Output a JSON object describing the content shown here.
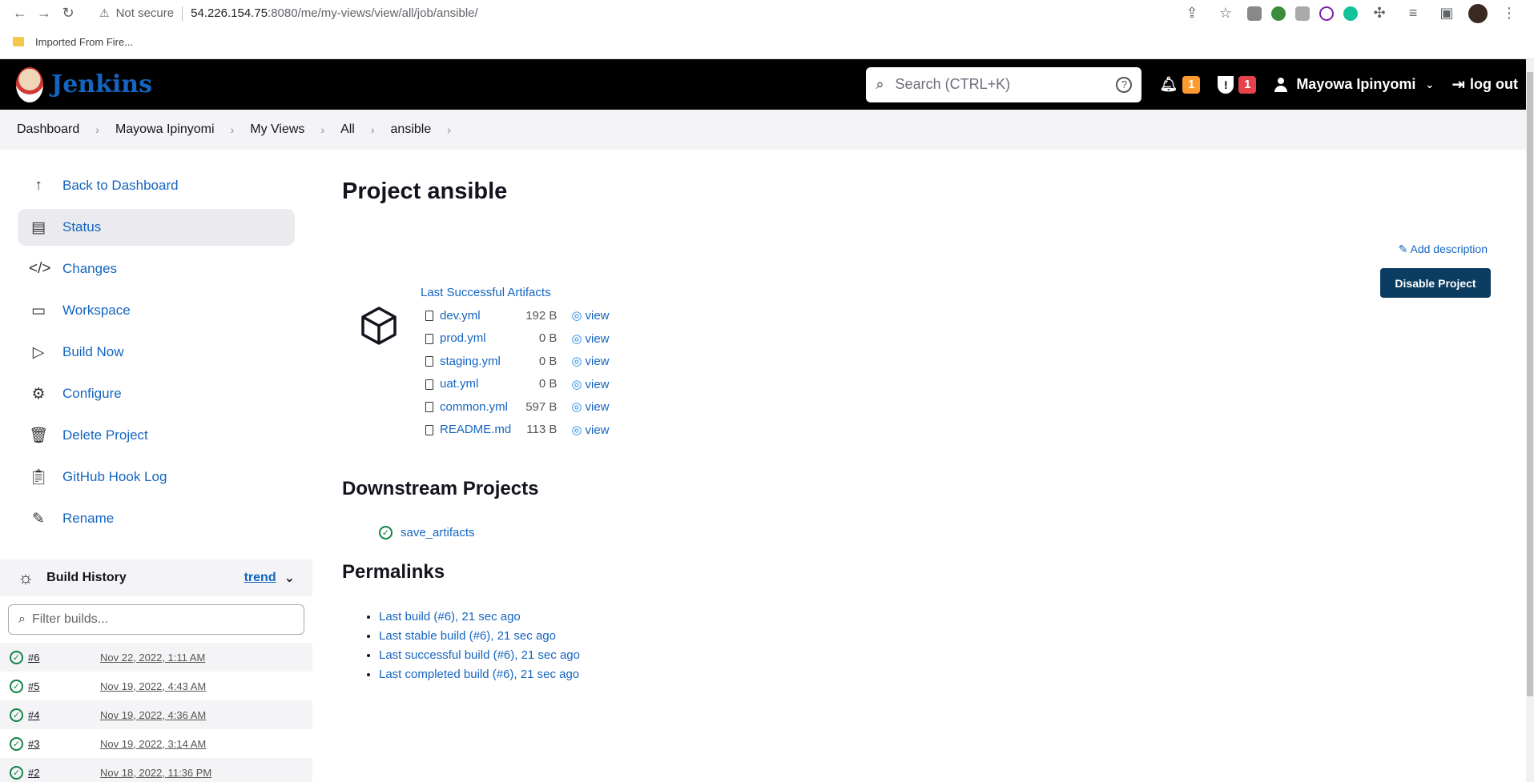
{
  "browser": {
    "security_label": "Not secure",
    "url_host": "54.226.154.75",
    "url_rest": ":8080/me/my-views/view/all/job/ansible/",
    "bookmark": "Imported From Fire..."
  },
  "header": {
    "brand": "Jenkins",
    "search_placeholder": "Search (CTRL+K)",
    "notifications_count": "1",
    "security_count": "1",
    "user_name": "Mayowa Ipinyomi",
    "logout": "log out"
  },
  "breadcrumbs": [
    "Dashboard",
    "Mayowa Ipinyomi",
    "My Views",
    "All",
    "ansible"
  ],
  "sidebar": {
    "tasks": [
      {
        "label": "Back to Dashboard",
        "icon": "arrow-up-icon"
      },
      {
        "label": "Status",
        "icon": "document-icon"
      },
      {
        "label": "Changes",
        "icon": "code-icon"
      },
      {
        "label": "Workspace",
        "icon": "folder-icon"
      },
      {
        "label": "Build Now",
        "icon": "play-icon"
      },
      {
        "label": "Configure",
        "icon": "gear-icon"
      },
      {
        "label": "Delete Project",
        "icon": "trash-icon"
      },
      {
        "label": "GitHub Hook Log",
        "icon": "clipboard-icon"
      },
      {
        "label": "Rename",
        "icon": "pencil-icon"
      }
    ]
  },
  "build_history": {
    "title": "Build History",
    "trend": "trend",
    "filter_placeholder": "Filter builds...",
    "builds": [
      {
        "num": "#6",
        "date": "Nov 22, 2022, 1:11 AM"
      },
      {
        "num": "#5",
        "date": "Nov 19, 2022, 4:43 AM"
      },
      {
        "num": "#4",
        "date": "Nov 19, 2022, 4:36 AM"
      },
      {
        "num": "#3",
        "date": "Nov 19, 2022, 3:14 AM"
      },
      {
        "num": "#2",
        "date": "Nov 18, 2022, 11:36 PM"
      }
    ]
  },
  "main": {
    "title": "Project ansible",
    "add_description": "Add description",
    "disable_button": "Disable Project",
    "artifacts_title": "Last Successful Artifacts",
    "artifacts": [
      {
        "name": "dev.yml",
        "size": "192 B",
        "view": "view"
      },
      {
        "name": "prod.yml",
        "size": "0 B",
        "view": "view"
      },
      {
        "name": "staging.yml",
        "size": "0 B",
        "view": "view"
      },
      {
        "name": "uat.yml",
        "size": "0 B",
        "view": "view"
      },
      {
        "name": "common.yml",
        "size": "597 B",
        "view": "view"
      },
      {
        "name": "README.md",
        "size": "113 B",
        "view": "view"
      }
    ],
    "downstream_title": "Downstream Projects",
    "downstream": [
      "save_artifacts"
    ],
    "permalinks_title": "Permalinks",
    "permalinks": [
      "Last build (#6), 21 sec ago",
      "Last stable build (#6), 21 sec ago",
      "Last successful build (#6), 21 sec ago",
      "Last completed build (#6), 21 sec ago"
    ]
  },
  "colors": {
    "header_bg": "#000000",
    "link": "#1565c0",
    "primary_button": "#0b3d62",
    "success": "#138347",
    "badge_orange": "#fe9a2e",
    "badge_red": "#e6424b"
  }
}
